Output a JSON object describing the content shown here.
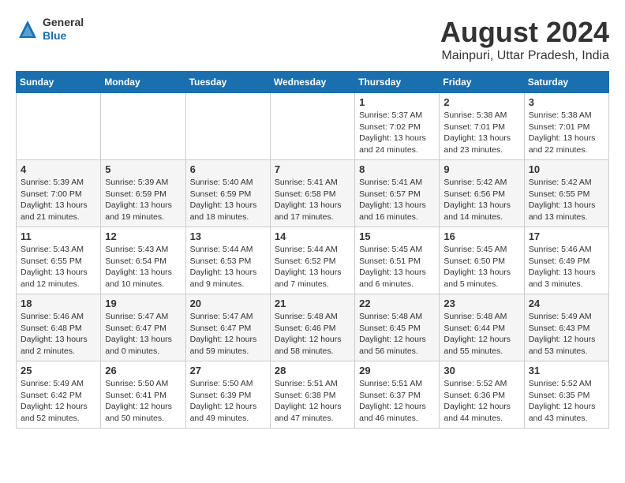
{
  "header": {
    "logo_general": "General",
    "logo_blue": "Blue",
    "title": "August 2024",
    "subtitle": "Mainpuri, Uttar Pradesh, India"
  },
  "days_of_week": [
    "Sunday",
    "Monday",
    "Tuesday",
    "Wednesday",
    "Thursday",
    "Friday",
    "Saturday"
  ],
  "weeks": [
    {
      "row_class": "row-odd",
      "cells": [
        {
          "date": "",
          "info": ""
        },
        {
          "date": "",
          "info": ""
        },
        {
          "date": "",
          "info": ""
        },
        {
          "date": "",
          "info": ""
        },
        {
          "date": "1",
          "info": "Sunrise: 5:37 AM\nSunset: 7:02 PM\nDaylight: 13 hours\nand 24 minutes."
        },
        {
          "date": "2",
          "info": "Sunrise: 5:38 AM\nSunset: 7:01 PM\nDaylight: 13 hours\nand 23 minutes."
        },
        {
          "date": "3",
          "info": "Sunrise: 5:38 AM\nSunset: 7:01 PM\nDaylight: 13 hours\nand 22 minutes."
        }
      ]
    },
    {
      "row_class": "row-even",
      "cells": [
        {
          "date": "4",
          "info": "Sunrise: 5:39 AM\nSunset: 7:00 PM\nDaylight: 13 hours\nand 21 minutes."
        },
        {
          "date": "5",
          "info": "Sunrise: 5:39 AM\nSunset: 6:59 PM\nDaylight: 13 hours\nand 19 minutes."
        },
        {
          "date": "6",
          "info": "Sunrise: 5:40 AM\nSunset: 6:59 PM\nDaylight: 13 hours\nand 18 minutes."
        },
        {
          "date": "7",
          "info": "Sunrise: 5:41 AM\nSunset: 6:58 PM\nDaylight: 13 hours\nand 17 minutes."
        },
        {
          "date": "8",
          "info": "Sunrise: 5:41 AM\nSunset: 6:57 PM\nDaylight: 13 hours\nand 16 minutes."
        },
        {
          "date": "9",
          "info": "Sunrise: 5:42 AM\nSunset: 6:56 PM\nDaylight: 13 hours\nand 14 minutes."
        },
        {
          "date": "10",
          "info": "Sunrise: 5:42 AM\nSunset: 6:55 PM\nDaylight: 13 hours\nand 13 minutes."
        }
      ]
    },
    {
      "row_class": "row-odd",
      "cells": [
        {
          "date": "11",
          "info": "Sunrise: 5:43 AM\nSunset: 6:55 PM\nDaylight: 13 hours\nand 12 minutes."
        },
        {
          "date": "12",
          "info": "Sunrise: 5:43 AM\nSunset: 6:54 PM\nDaylight: 13 hours\nand 10 minutes."
        },
        {
          "date": "13",
          "info": "Sunrise: 5:44 AM\nSunset: 6:53 PM\nDaylight: 13 hours\nand 9 minutes."
        },
        {
          "date": "14",
          "info": "Sunrise: 5:44 AM\nSunset: 6:52 PM\nDaylight: 13 hours\nand 7 minutes."
        },
        {
          "date": "15",
          "info": "Sunrise: 5:45 AM\nSunset: 6:51 PM\nDaylight: 13 hours\nand 6 minutes."
        },
        {
          "date": "16",
          "info": "Sunrise: 5:45 AM\nSunset: 6:50 PM\nDaylight: 13 hours\nand 5 minutes."
        },
        {
          "date": "17",
          "info": "Sunrise: 5:46 AM\nSunset: 6:49 PM\nDaylight: 13 hours\nand 3 minutes."
        }
      ]
    },
    {
      "row_class": "row-even",
      "cells": [
        {
          "date": "18",
          "info": "Sunrise: 5:46 AM\nSunset: 6:48 PM\nDaylight: 13 hours\nand 2 minutes."
        },
        {
          "date": "19",
          "info": "Sunrise: 5:47 AM\nSunset: 6:47 PM\nDaylight: 13 hours\nand 0 minutes."
        },
        {
          "date": "20",
          "info": "Sunrise: 5:47 AM\nSunset: 6:47 PM\nDaylight: 12 hours\nand 59 minutes."
        },
        {
          "date": "21",
          "info": "Sunrise: 5:48 AM\nSunset: 6:46 PM\nDaylight: 12 hours\nand 58 minutes."
        },
        {
          "date": "22",
          "info": "Sunrise: 5:48 AM\nSunset: 6:45 PM\nDaylight: 12 hours\nand 56 minutes."
        },
        {
          "date": "23",
          "info": "Sunrise: 5:48 AM\nSunset: 6:44 PM\nDaylight: 12 hours\nand 55 minutes."
        },
        {
          "date": "24",
          "info": "Sunrise: 5:49 AM\nSunset: 6:43 PM\nDaylight: 12 hours\nand 53 minutes."
        }
      ]
    },
    {
      "row_class": "row-odd",
      "cells": [
        {
          "date": "25",
          "info": "Sunrise: 5:49 AM\nSunset: 6:42 PM\nDaylight: 12 hours\nand 52 minutes."
        },
        {
          "date": "26",
          "info": "Sunrise: 5:50 AM\nSunset: 6:41 PM\nDaylight: 12 hours\nand 50 minutes."
        },
        {
          "date": "27",
          "info": "Sunrise: 5:50 AM\nSunset: 6:39 PM\nDaylight: 12 hours\nand 49 minutes."
        },
        {
          "date": "28",
          "info": "Sunrise: 5:51 AM\nSunset: 6:38 PM\nDaylight: 12 hours\nand 47 minutes."
        },
        {
          "date": "29",
          "info": "Sunrise: 5:51 AM\nSunset: 6:37 PM\nDaylight: 12 hours\nand 46 minutes."
        },
        {
          "date": "30",
          "info": "Sunrise: 5:52 AM\nSunset: 6:36 PM\nDaylight: 12 hours\nand 44 minutes."
        },
        {
          "date": "31",
          "info": "Sunrise: 5:52 AM\nSunset: 6:35 PM\nDaylight: 12 hours\nand 43 minutes."
        }
      ]
    }
  ]
}
